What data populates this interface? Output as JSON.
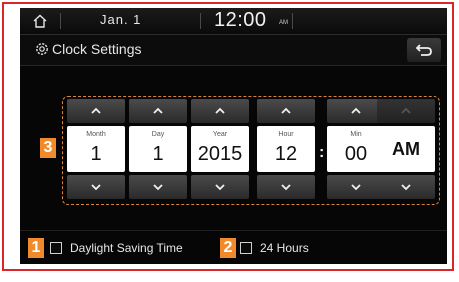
{
  "status_bar": {
    "home_icon": "home-icon",
    "date": "Jan.  1",
    "time": "12:00",
    "ampm": "AM"
  },
  "title_bar": {
    "title": "Clock Settings",
    "settings_icon": "gear-icon",
    "back_icon": "back-arrow-icon"
  },
  "picker": {
    "badge": "3",
    "month": {
      "label": "Month",
      "value": "1"
    },
    "day": {
      "label": "Day",
      "value": "1"
    },
    "year": {
      "label": "Year",
      "value": "2015"
    },
    "hour": {
      "label": "Hour",
      "value": "12"
    },
    "minute": {
      "label": "Min",
      "value": "00"
    },
    "ampm": {
      "value": "AM"
    },
    "colon": ":"
  },
  "options": {
    "daylight": {
      "badge": "1",
      "label": "Daylight Saving Time",
      "checked": false
    },
    "hours24": {
      "badge": "2",
      "label": "24 Hours",
      "checked": false
    }
  },
  "colors": {
    "frame": "#d9262b",
    "badge": "#f08a2a",
    "highlight_border": "#d6863c"
  }
}
